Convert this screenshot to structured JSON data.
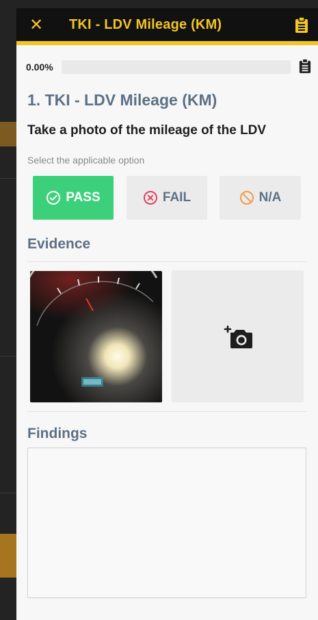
{
  "header": {
    "title": "TKI - LDV Mileage (KM)",
    "close_icon": "close-icon",
    "clipboard_icon": "clipboard-icon"
  },
  "progress": {
    "text": "0.00%",
    "value": 0
  },
  "question": {
    "title": "1. TKI - LDV Mileage (KM)",
    "prompt": "Take a photo of the mileage of the LDV",
    "hint": "Select the applicable option"
  },
  "options": [
    {
      "label": "PASS",
      "icon": "check-circle-icon",
      "selected": true,
      "color": "#3dd07a"
    },
    {
      "label": "FAIL",
      "icon": "x-circle-icon",
      "selected": false,
      "color": "#e0405e"
    },
    {
      "label": "N/A",
      "icon": "ban-icon",
      "selected": false,
      "color": "#f29a4a"
    }
  ],
  "evidence": {
    "title": "Evidence",
    "add_icon": "add-photo-icon"
  },
  "findings": {
    "title": "Findings",
    "value": ""
  },
  "colors": {
    "accent": "#f3c623",
    "pass": "#3dd07a",
    "heading": "#5c7185"
  }
}
